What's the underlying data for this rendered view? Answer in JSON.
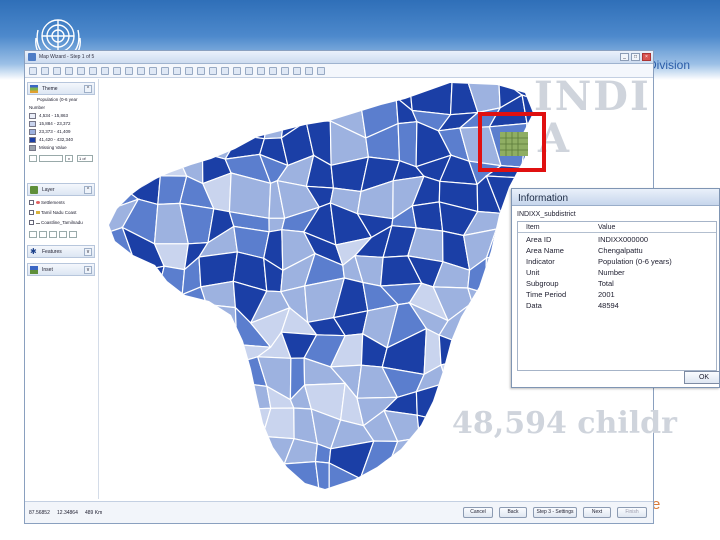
{
  "slide": {
    "division_text": "Division",
    "overlay_line1": "INDI",
    "overlay_line2": "A",
    "bottom_overlay": "48,594 childr",
    "bottom_fragment": "e"
  },
  "colors": {
    "brand_blue": "#2f6fb8",
    "highlight_red": "#e01010",
    "map_shades": [
      "#eaeef9",
      "#c9d4ee",
      "#9db2e0",
      "#5b7ece",
      "#1b3fa6"
    ]
  },
  "window": {
    "title": "Map Wizard - Step 1 of 5",
    "controls": [
      "_",
      "□",
      "×"
    ]
  },
  "theme_panel": {
    "title": "Theme",
    "legend_title": "Population (0-6 year",
    "legend_subtitle": "Number",
    "legend": [
      {
        "range": "4,534 - 15,863",
        "color": "#eaeef9"
      },
      {
        "range": "15,884 - 23,372",
        "color": "#c9d4ee"
      },
      {
        "range": "23,373 - 41,409",
        "color": "#9db2e0"
      },
      {
        "range": "41,420 - 432,340",
        "color": "#1b3fa6"
      },
      {
        "range": "Missing Value",
        "color": "#9aa2ad"
      }
    ],
    "control_value": "1 of"
  },
  "layer_panel": {
    "title": "Layer",
    "items": [
      "Settlements",
      "Tamil Nadu Coast",
      "Coastline_Tamilnadu"
    ]
  },
  "features_panel": {
    "title": "Features"
  },
  "inset_panel": {
    "title": "Inset"
  },
  "info": {
    "title": "Information",
    "layer": "INDIXX_subdistrict",
    "col_item": "Item",
    "col_value": "Value",
    "rows": [
      {
        "item": "Area ID",
        "value": "INDIXX000000"
      },
      {
        "item": "Area Name",
        "value": "Chengalpattu"
      },
      {
        "item": "Indicator",
        "value": "Population (0-6 years)"
      },
      {
        "item": "Unit",
        "value": "Number"
      },
      {
        "item": "Subgroup",
        "value": "Total"
      },
      {
        "item": "Time Period",
        "value": "2001"
      },
      {
        "item": "Data",
        "value": "48594"
      }
    ],
    "ok": "OK"
  },
  "statusbar": {
    "coord_x": "87.56852",
    "coord_y": "12.34864",
    "scale": "489 Km",
    "cancel": "Cancel",
    "back": "Back",
    "step": "Step 3 - Settings",
    "next": "Next",
    "finish": "Finish"
  }
}
